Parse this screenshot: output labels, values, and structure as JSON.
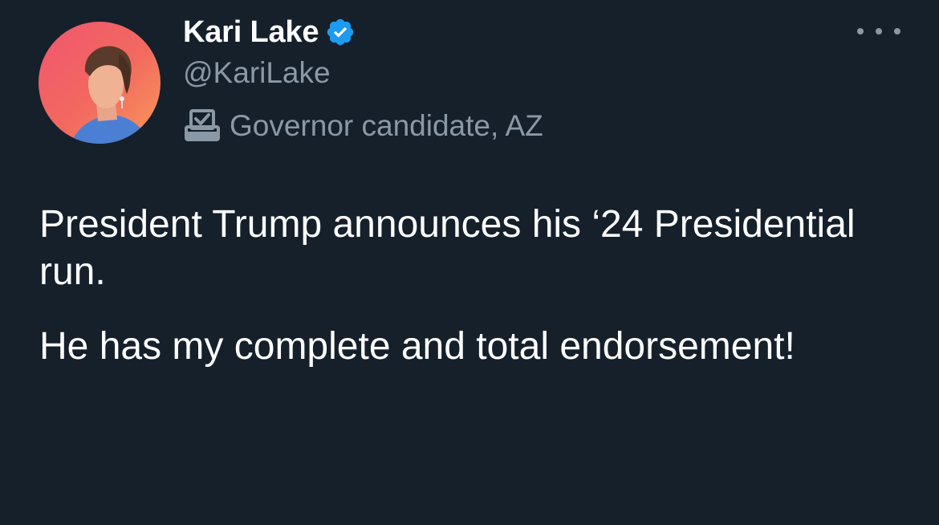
{
  "author": {
    "name": "Kari Lake",
    "handle": "@KariLake",
    "verified": true,
    "affiliation": "Governor candidate, AZ",
    "avatar": "profile-photo"
  },
  "tweet": {
    "paragraphs": [
      "President Trump announces his ‘24 Presidential run.",
      "He has my complete and total endorsement!"
    ]
  },
  "icons": {
    "verified": "verified-badge-icon",
    "affiliation": "ballot-box-icon",
    "more": "more-options-icon"
  },
  "colors": {
    "background": "#15202b",
    "primary_text": "#ffffff",
    "secondary_text": "#8b98a5",
    "verified_blue": "#1d9bf0"
  }
}
